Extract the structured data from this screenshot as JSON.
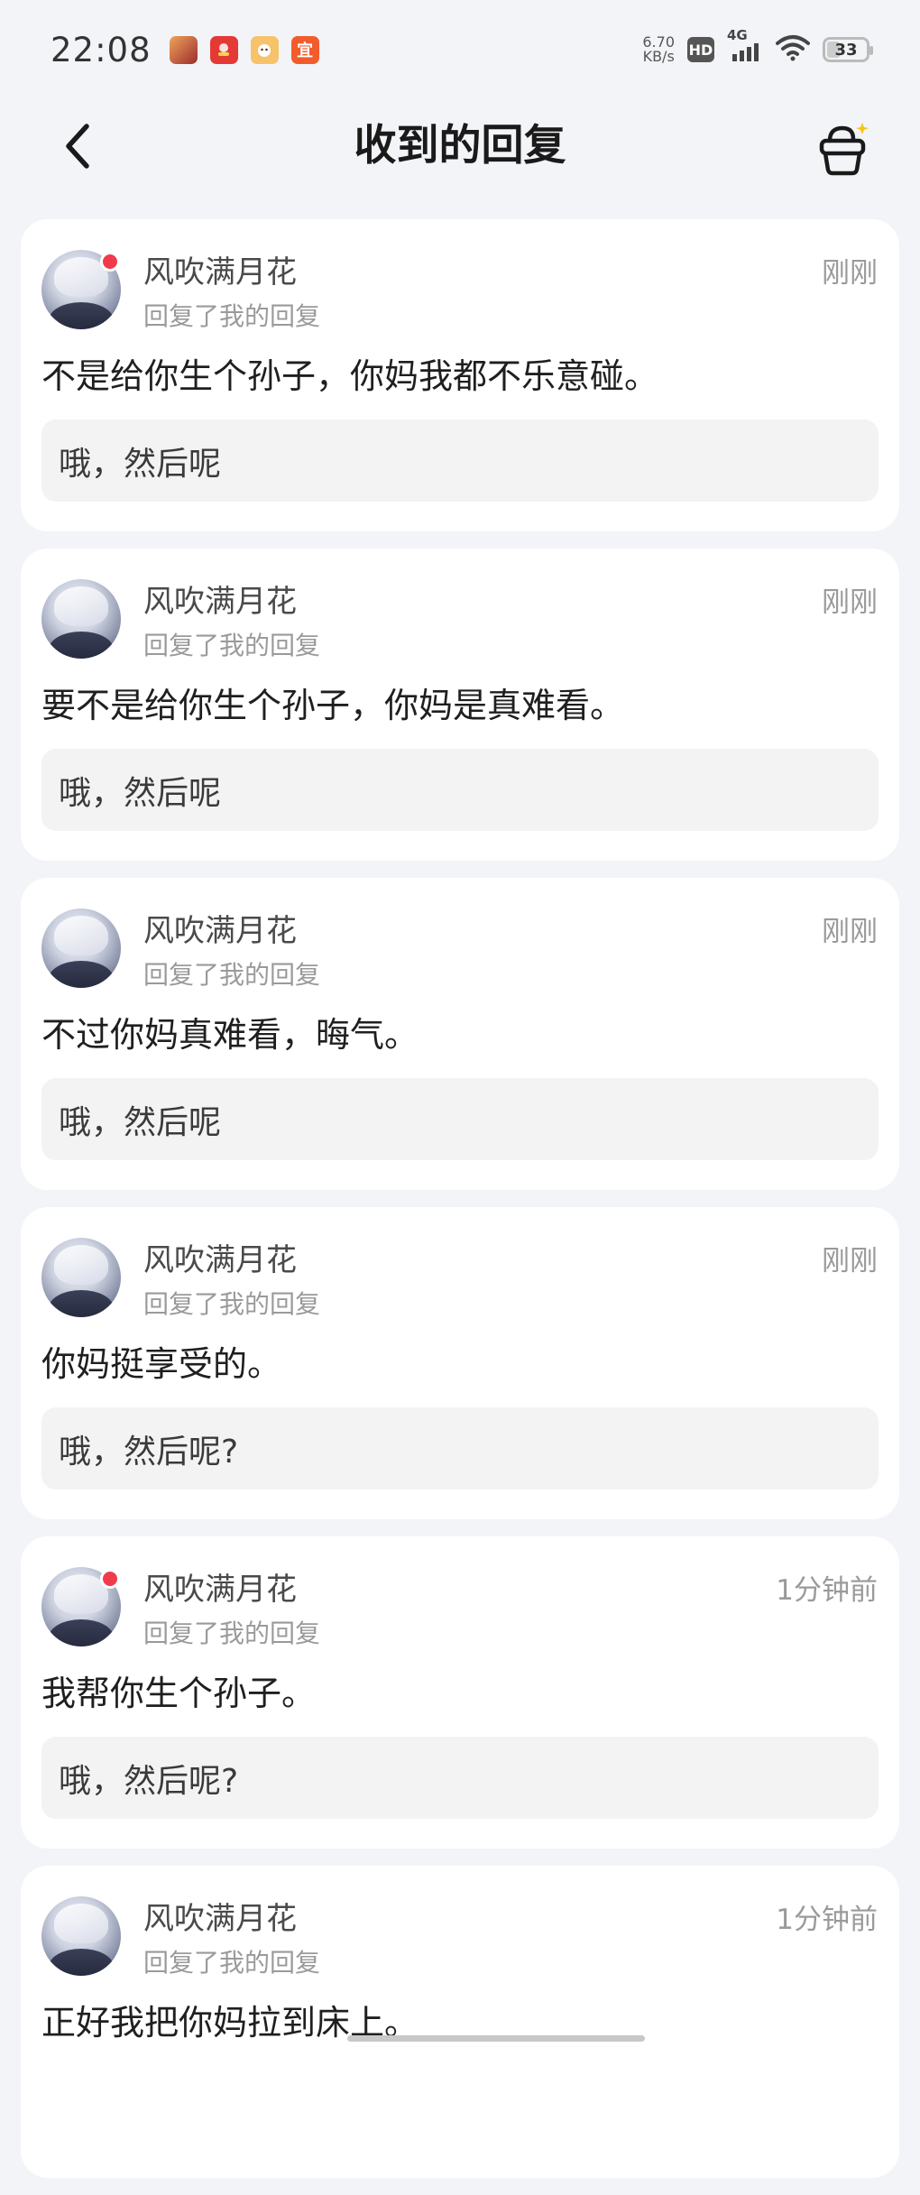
{
  "status_bar": {
    "time": "22:08",
    "net_speed_value": "6.70",
    "net_speed_unit": "KB/s",
    "hd_badge": "HD",
    "network": "4G",
    "battery": "33",
    "app_icons": [
      {
        "name": "game-app-icon",
        "color": "#c0392b"
      },
      {
        "name": "red-app-icon",
        "color": "#e53935"
      },
      {
        "name": "orange-app-icon",
        "color": "#f4a13a"
      },
      {
        "name": "yi-app-icon",
        "color": "#f25c2c",
        "glyph": "宜"
      }
    ]
  },
  "header": {
    "title": "收到的回复",
    "back_icon": "chevron-left-icon",
    "shop_icon": "shopping-basket-icon"
  },
  "replies": [
    {
      "user": "风吹满月花",
      "action": "回复了我的回复",
      "time": "刚刚",
      "content": "不是给你生个孙子，你妈我都不乐意碰。",
      "quote": "哦，然后呢",
      "unread": true
    },
    {
      "user": "风吹满月花",
      "action": "回复了我的回复",
      "time": "刚刚",
      "content": "要不是给你生个孙子，你妈是真难看。",
      "quote": "哦，然后呢",
      "unread": false
    },
    {
      "user": "风吹满月花",
      "action": "回复了我的回复",
      "time": "刚刚",
      "content": "不过你妈真难看，晦气。",
      "quote": "哦，然后呢",
      "unread": false
    },
    {
      "user": "风吹满月花",
      "action": "回复了我的回复",
      "time": "刚刚",
      "content": "你妈挺享受的。",
      "quote": "哦，然后呢?",
      "unread": false
    },
    {
      "user": "风吹满月花",
      "action": "回复了我的回复",
      "time": "1分钟前",
      "content": "我帮你生个孙子。",
      "quote": "哦，然后呢?",
      "unread": true
    },
    {
      "user": "风吹满月花",
      "action": "回复了我的回复",
      "time": "1分钟前",
      "content": "正好我把你妈拉到床上。",
      "quote": "",
      "unread": false
    }
  ],
  "colors": {
    "background": "#f2f4f7",
    "card": "#ffffff",
    "unread_dot": "#ef3b4b",
    "quote_bg": "#f3f3f4"
  }
}
